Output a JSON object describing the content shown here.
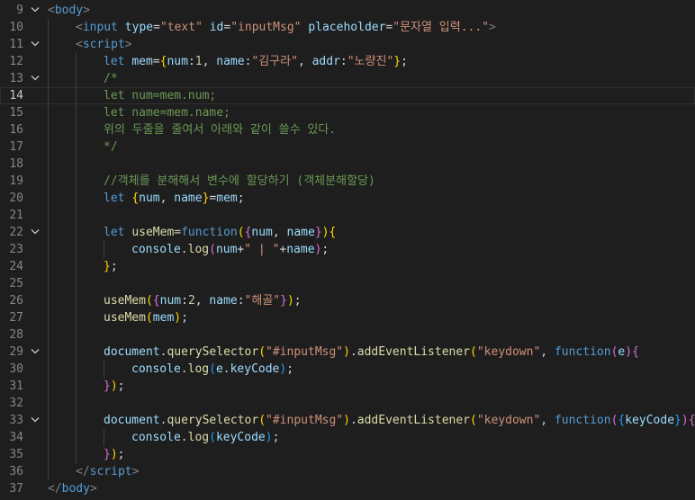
{
  "current_line": 14,
  "colors": {
    "background": "#1e1e1e",
    "line_number": "#858585",
    "tag": "#569cd6",
    "attribute": "#9cdcfe",
    "string": "#ce9178",
    "comment": "#6a9955",
    "function": "#dcdcaa",
    "number": "#b5cea8",
    "bracket_gold": "#ffd700",
    "bracket_purple": "#da70d6",
    "bracket_blue": "#179fff"
  },
  "lines": [
    {
      "n": "9",
      "fold": true,
      "indent": 0,
      "tokens": [
        [
          "t-brk",
          "<"
        ],
        [
          "t-tag",
          "body"
        ],
        [
          "t-brk",
          ">"
        ]
      ]
    },
    {
      "n": "10",
      "fold": false,
      "indent": 1,
      "tokens": [
        [
          "t-brk",
          "<"
        ],
        [
          "t-tag",
          "input"
        ],
        [
          "t-p",
          " "
        ],
        [
          "t-attr",
          "type"
        ],
        [
          "t-p",
          "="
        ],
        [
          "t-str",
          "\"text\""
        ],
        [
          "t-p",
          " "
        ],
        [
          "t-attr",
          "id"
        ],
        [
          "t-p",
          "="
        ],
        [
          "t-str",
          "\"inputMsg\""
        ],
        [
          "t-p",
          " "
        ],
        [
          "t-attr",
          "placeholder"
        ],
        [
          "t-p",
          "="
        ],
        [
          "t-str",
          "\"문자열 입력...\""
        ],
        [
          "t-brk",
          ">"
        ]
      ]
    },
    {
      "n": "11",
      "fold": true,
      "indent": 1,
      "tokens": [
        [
          "t-brk",
          "<"
        ],
        [
          "t-tag",
          "script"
        ],
        [
          "t-brk",
          ">"
        ]
      ]
    },
    {
      "n": "12",
      "fold": false,
      "indent": 2,
      "tokens": [
        [
          "t-kw",
          "let"
        ],
        [
          "t-p",
          " "
        ],
        [
          "t-var",
          "mem"
        ],
        [
          "t-p",
          "="
        ],
        [
          "t-b1",
          "{"
        ],
        [
          "t-var",
          "num"
        ],
        [
          "t-p",
          ":"
        ],
        [
          "t-num",
          "1"
        ],
        [
          "t-p",
          ", "
        ],
        [
          "t-var",
          "name"
        ],
        [
          "t-p",
          ":"
        ],
        [
          "t-str",
          "\"김구라\""
        ],
        [
          "t-p",
          ", "
        ],
        [
          "t-var",
          "addr"
        ],
        [
          "t-p",
          ":"
        ],
        [
          "t-str",
          "\"노량진\""
        ],
        [
          "t-b1",
          "}"
        ],
        [
          "t-p",
          ";"
        ]
      ]
    },
    {
      "n": "13",
      "fold": true,
      "indent": 2,
      "tokens": [
        [
          "t-com",
          "/*"
        ]
      ]
    },
    {
      "n": "14",
      "fold": false,
      "indent": 2,
      "tokens": [
        [
          "t-com",
          "let num=mem.num;"
        ]
      ]
    },
    {
      "n": "15",
      "fold": false,
      "indent": 2,
      "tokens": [
        [
          "t-com",
          "let name=mem.name;"
        ]
      ]
    },
    {
      "n": "16",
      "fold": false,
      "indent": 2,
      "tokens": [
        [
          "t-com",
          "위의 두줄을 줄여서 아래와 같이 쓸수 있다."
        ]
      ]
    },
    {
      "n": "17",
      "fold": false,
      "indent": 2,
      "tokens": [
        [
          "t-com",
          "*/"
        ]
      ]
    },
    {
      "n": "18",
      "fold": false,
      "indent": 2,
      "tokens": []
    },
    {
      "n": "19",
      "fold": false,
      "indent": 2,
      "tokens": [
        [
          "t-com",
          "//객체를 분해해서 변수에 할당하기 (객체분해할당)"
        ]
      ]
    },
    {
      "n": "20",
      "fold": false,
      "indent": 2,
      "tokens": [
        [
          "t-kw",
          "let"
        ],
        [
          "t-p",
          " "
        ],
        [
          "t-b1",
          "{"
        ],
        [
          "t-var",
          "num"
        ],
        [
          "t-p",
          ", "
        ],
        [
          "t-var",
          "name"
        ],
        [
          "t-b1",
          "}"
        ],
        [
          "t-p",
          "="
        ],
        [
          "t-var",
          "mem"
        ],
        [
          "t-p",
          ";"
        ]
      ]
    },
    {
      "n": "21",
      "fold": false,
      "indent": 2,
      "tokens": []
    },
    {
      "n": "22",
      "fold": true,
      "indent": 2,
      "tokens": [
        [
          "t-kw",
          "let"
        ],
        [
          "t-p",
          " "
        ],
        [
          "t-fn",
          "useMem"
        ],
        [
          "t-p",
          "="
        ],
        [
          "t-kw",
          "function"
        ],
        [
          "t-b1",
          "("
        ],
        [
          "t-b2",
          "{"
        ],
        [
          "t-var",
          "num"
        ],
        [
          "t-p",
          ", "
        ],
        [
          "t-var",
          "name"
        ],
        [
          "t-b2",
          "}"
        ],
        [
          "t-b1",
          ")"
        ],
        [
          "t-b1",
          "{"
        ]
      ]
    },
    {
      "n": "23",
      "fold": false,
      "indent": 3,
      "tokens": [
        [
          "t-var",
          "console"
        ],
        [
          "t-p",
          "."
        ],
        [
          "t-fn",
          "log"
        ],
        [
          "t-b2",
          "("
        ],
        [
          "t-var",
          "num"
        ],
        [
          "t-p",
          "+"
        ],
        [
          "t-str",
          "\" | \""
        ],
        [
          "t-p",
          "+"
        ],
        [
          "t-var",
          "name"
        ],
        [
          "t-b2",
          ")"
        ],
        [
          "t-p",
          ";"
        ]
      ]
    },
    {
      "n": "24",
      "fold": false,
      "indent": 2,
      "tokens": [
        [
          "t-b1",
          "}"
        ],
        [
          "t-p",
          ";"
        ]
      ]
    },
    {
      "n": "25",
      "fold": false,
      "indent": 2,
      "tokens": []
    },
    {
      "n": "26",
      "fold": false,
      "indent": 2,
      "tokens": [
        [
          "t-fn",
          "useMem"
        ],
        [
          "t-b1",
          "("
        ],
        [
          "t-b2",
          "{"
        ],
        [
          "t-var",
          "num"
        ],
        [
          "t-p",
          ":"
        ],
        [
          "t-num",
          "2"
        ],
        [
          "t-p",
          ", "
        ],
        [
          "t-var",
          "name"
        ],
        [
          "t-p",
          ":"
        ],
        [
          "t-str",
          "\"해골\""
        ],
        [
          "t-b2",
          "}"
        ],
        [
          "t-b1",
          ")"
        ],
        [
          "t-p",
          ";"
        ]
      ]
    },
    {
      "n": "27",
      "fold": false,
      "indent": 2,
      "tokens": [
        [
          "t-fn",
          "useMem"
        ],
        [
          "t-b1",
          "("
        ],
        [
          "t-var",
          "mem"
        ],
        [
          "t-b1",
          ")"
        ],
        [
          "t-p",
          ";"
        ]
      ]
    },
    {
      "n": "28",
      "fold": false,
      "indent": 2,
      "tokens": []
    },
    {
      "n": "29",
      "fold": true,
      "indent": 2,
      "tokens": [
        [
          "t-var",
          "document"
        ],
        [
          "t-p",
          "."
        ],
        [
          "t-fn",
          "querySelector"
        ],
        [
          "t-b1",
          "("
        ],
        [
          "t-str",
          "\"#inputMsg\""
        ],
        [
          "t-b1",
          ")"
        ],
        [
          "t-p",
          "."
        ],
        [
          "t-fn",
          "addEventListener"
        ],
        [
          "t-b1",
          "("
        ],
        [
          "t-str",
          "\"keydown\""
        ],
        [
          "t-p",
          ", "
        ],
        [
          "t-kw",
          "function"
        ],
        [
          "t-b2",
          "("
        ],
        [
          "t-var",
          "e"
        ],
        [
          "t-b2",
          ")"
        ],
        [
          "t-b2",
          "{"
        ]
      ]
    },
    {
      "n": "30",
      "fold": false,
      "indent": 3,
      "tokens": [
        [
          "t-var",
          "console"
        ],
        [
          "t-p",
          "."
        ],
        [
          "t-fn",
          "log"
        ],
        [
          "t-b3",
          "("
        ],
        [
          "t-var",
          "e"
        ],
        [
          "t-p",
          "."
        ],
        [
          "t-var",
          "keyCode"
        ],
        [
          "t-b3",
          ")"
        ],
        [
          "t-p",
          ";"
        ]
      ]
    },
    {
      "n": "31",
      "fold": false,
      "indent": 2,
      "tokens": [
        [
          "t-b2",
          "}"
        ],
        [
          "t-b1",
          ")"
        ],
        [
          "t-p",
          ";"
        ]
      ]
    },
    {
      "n": "32",
      "fold": false,
      "indent": 2,
      "tokens": []
    },
    {
      "n": "33",
      "fold": true,
      "indent": 2,
      "tokens": [
        [
          "t-var",
          "document"
        ],
        [
          "t-p",
          "."
        ],
        [
          "t-fn",
          "querySelector"
        ],
        [
          "t-b1",
          "("
        ],
        [
          "t-str",
          "\"#inputMsg\""
        ],
        [
          "t-b1",
          ")"
        ],
        [
          "t-p",
          "."
        ],
        [
          "t-fn",
          "addEventListener"
        ],
        [
          "t-b1",
          "("
        ],
        [
          "t-str",
          "\"keydown\""
        ],
        [
          "t-p",
          ", "
        ],
        [
          "t-kw",
          "function"
        ],
        [
          "t-b2",
          "("
        ],
        [
          "t-b3",
          "{"
        ],
        [
          "t-var",
          "keyCode"
        ],
        [
          "t-b3",
          "}"
        ],
        [
          "t-b2",
          ")"
        ],
        [
          "t-b2",
          "{"
        ]
      ]
    },
    {
      "n": "34",
      "fold": false,
      "indent": 3,
      "tokens": [
        [
          "t-var",
          "console"
        ],
        [
          "t-p",
          "."
        ],
        [
          "t-fn",
          "log"
        ],
        [
          "t-b3",
          "("
        ],
        [
          "t-var",
          "keyCode"
        ],
        [
          "t-b3",
          ")"
        ],
        [
          "t-p",
          ";"
        ]
      ]
    },
    {
      "n": "35",
      "fold": false,
      "indent": 2,
      "tokens": [
        [
          "t-b2",
          "}"
        ],
        [
          "t-b1",
          ")"
        ],
        [
          "t-p",
          ";"
        ]
      ]
    },
    {
      "n": "36",
      "fold": false,
      "indent": 1,
      "tokens": [
        [
          "t-brk",
          "</"
        ],
        [
          "t-tag",
          "script"
        ],
        [
          "t-brk",
          ">"
        ]
      ]
    },
    {
      "n": "37",
      "fold": false,
      "indent": 0,
      "tokens": [
        [
          "t-brk",
          "</"
        ],
        [
          "t-tag",
          "body"
        ],
        [
          "t-brk",
          ">"
        ]
      ]
    }
  ]
}
